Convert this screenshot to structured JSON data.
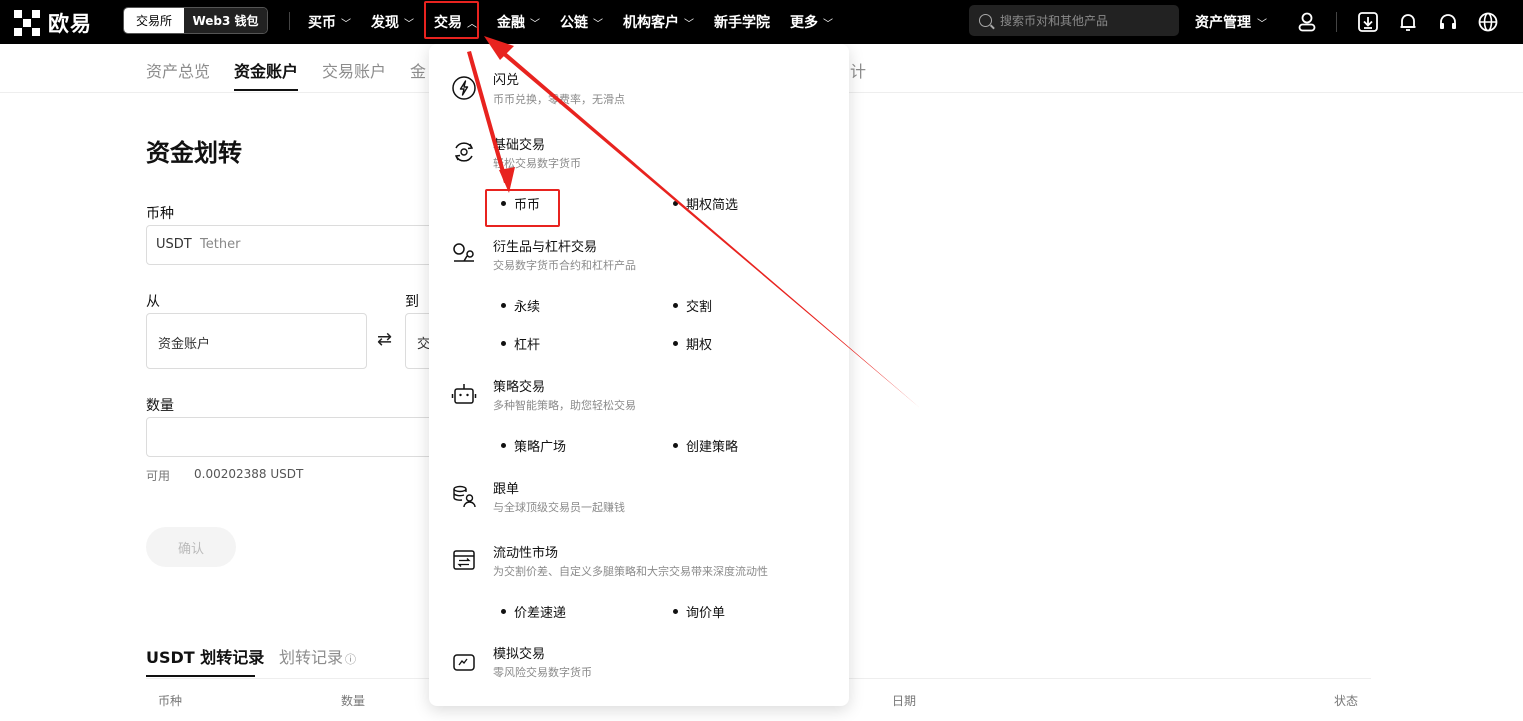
{
  "header": {
    "logo_text": "欧易",
    "mode_exchange": "交易所",
    "mode_web3": "Web3 钱包",
    "nav": [
      "买币",
      "发现",
      "交易",
      "金融",
      "公链",
      "机构客户",
      "新手学院",
      "更多"
    ],
    "search_placeholder": "搜索币对和其他产品",
    "asset_mgmt": "资产管理"
  },
  "subnav": {
    "items": [
      "资产总览",
      "资金账户",
      "交易账户",
      "金",
      "计"
    ]
  },
  "form": {
    "title": "资金划转",
    "currency_label": "币种",
    "currency_code": "USDT",
    "currency_name": "Tether",
    "from_label": "从",
    "to_label": "到",
    "from_value": "资金账户",
    "to_value": "交",
    "swap_glyph": "⇄",
    "amount_label": "数量",
    "available_label": "可用",
    "available_value": "0.00202388 USDT",
    "confirm": "确认"
  },
  "records": {
    "tab_active": "USDT 划转记录",
    "tab_inactive": "划转记录",
    "info_glyph": "ⓘ",
    "columns": [
      "币种",
      "数量",
      "日期",
      "状态"
    ]
  },
  "dropdown": {
    "flash_title": "闪兑",
    "flash_desc": "币币兑换，零费率，无滑点",
    "basic_title": "基础交易",
    "basic_desc": "轻松交易数字货币",
    "basic_subs": [
      "币币",
      "期权简选"
    ],
    "deriv_title": "衍生品与杠杆交易",
    "deriv_desc": "交易数字货币合约和杠杆产品",
    "deriv_subs": [
      "永续",
      "交割",
      "杠杆",
      "期权"
    ],
    "strategy_title": "策略交易",
    "strategy_desc": "多种智能策略，助您轻松交易",
    "strategy_subs": [
      "策略广场",
      "创建策略"
    ],
    "copy_title": "跟单",
    "copy_desc": "与全球顶级交易员一起赚钱",
    "liquidity_title": "流动性市场",
    "liquidity_desc": "为交割价差、自定义多腿策略和大宗交易带来深度流动性",
    "liquidity_subs": [
      "价差速递",
      "询价单"
    ],
    "demo_title": "模拟交易",
    "demo_desc": "零风险交易数字货币"
  },
  "colors": {
    "highlight": "#e8231f",
    "topbar": "#000000"
  }
}
